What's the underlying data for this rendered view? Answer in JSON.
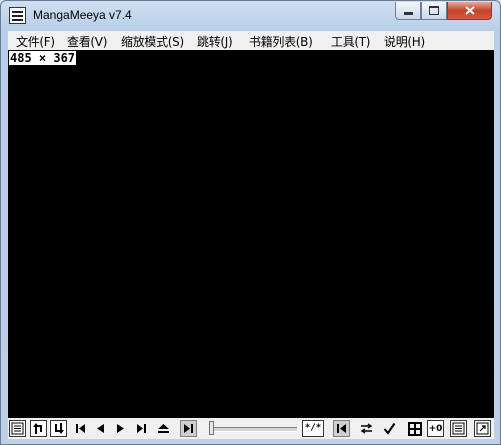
{
  "window": {
    "title": "MangaMeeya v7.4"
  },
  "menu": [
    {
      "label": "文件(F)"
    },
    {
      "label": "查看(V)"
    },
    {
      "label": "缩放模式(S)"
    },
    {
      "label": "跳转(J)"
    },
    {
      "label": "书籍列表(B)"
    },
    {
      "label": "工具(T)"
    },
    {
      "label": "说明(H)"
    }
  ],
  "viewport": {
    "size_label": "485 × 367",
    "background": "#000000"
  },
  "toolbar": {
    "page_indicator": "*/*",
    "offset_label": "+0",
    "slider_position": 0
  },
  "icons": {
    "app": "app-icon",
    "minimize": "minimize-icon",
    "maximize": "maximize-icon",
    "close": "close-icon"
  }
}
